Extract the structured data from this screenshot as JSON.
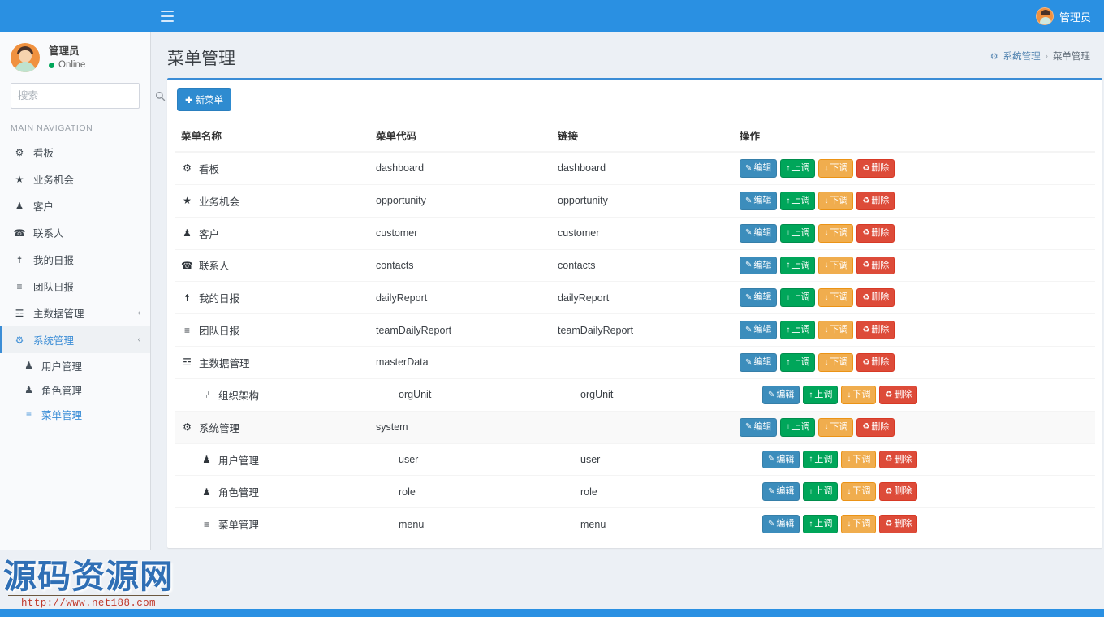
{
  "topbar": {
    "menu_toggle_icon": "hamburger-icon",
    "user_name": "管理员",
    "avatar_icon": "user-avatar-icon"
  },
  "sidebar": {
    "user": {
      "name": "管理员",
      "status": "Online",
      "avatar_icon": "user-avatar-icon"
    },
    "search": {
      "placeholder": "搜索",
      "value": "",
      "icon": "search-icon"
    },
    "nav_header": "MAIN NAVIGATION",
    "items": [
      {
        "label": "看板",
        "icon": "dashboard-icon",
        "glyph": "⚙",
        "arrow": "",
        "active": false
      },
      {
        "label": "业务机会",
        "icon": "star-icon",
        "glyph": "★",
        "arrow": "",
        "active": false
      },
      {
        "label": "客户",
        "icon": "customer-icon",
        "glyph": "♟",
        "arrow": "",
        "active": false
      },
      {
        "label": "联系人",
        "icon": "phone-icon",
        "glyph": "☎",
        "arrow": "",
        "active": false
      },
      {
        "label": "我的日报",
        "icon": "pin-icon",
        "glyph": "☨",
        "arrow": "",
        "active": false
      },
      {
        "label": "团队日报",
        "icon": "list-icon",
        "glyph": "≡",
        "arrow": "",
        "active": false
      },
      {
        "label": "主数据管理",
        "icon": "database-icon",
        "glyph": "☲",
        "arrow": "‹",
        "active": false
      },
      {
        "label": "系统管理",
        "icon": "gear-icon",
        "glyph": "⚙",
        "arrow": "‹",
        "active": true
      }
    ],
    "sub_items": [
      {
        "label": "用户管理",
        "icon": "user-icon",
        "glyph": "♟",
        "current": false
      },
      {
        "label": "角色管理",
        "icon": "users-icon",
        "glyph": "♟",
        "current": false
      },
      {
        "label": "菜单管理",
        "icon": "menu-list-icon",
        "glyph": "≡",
        "current": true
      }
    ]
  },
  "page": {
    "title": "菜单管理",
    "breadcrumb": {
      "icon": "gear-icon",
      "parent": "系统管理",
      "separator": "›",
      "current": "菜单管理"
    },
    "new_button": {
      "label": "新菜单",
      "icon": "plus-icon"
    }
  },
  "table": {
    "columns": [
      "菜单名称",
      "菜单代码",
      "链接",
      "操作"
    ],
    "action_labels": {
      "edit": "编辑",
      "up": "上调",
      "down": "下调",
      "delete": "删除"
    },
    "action_icons": {
      "edit": "edit-pencil-icon",
      "up": "arrow-up-icon",
      "down": "arrow-down-icon",
      "delete": "trash-icon"
    },
    "action_glyphs": {
      "edit": "✎",
      "up": "↑",
      "down": "↓",
      "delete": "Ὕ1"
    },
    "rows": [
      {
        "name": "看板",
        "code": "dashboard",
        "link": "dashboard",
        "icon": "dashboard-icon",
        "glyph": "⚙",
        "indent": false,
        "alt": false
      },
      {
        "name": "业务机会",
        "code": "opportunity",
        "link": "opportunity",
        "icon": "star-icon",
        "glyph": "★",
        "indent": false,
        "alt": false
      },
      {
        "name": "客户",
        "code": "customer",
        "link": "customer",
        "icon": "customer-icon",
        "glyph": "♟",
        "indent": false,
        "alt": false
      },
      {
        "name": "联系人",
        "code": "contacts",
        "link": "contacts",
        "icon": "phone-icon",
        "glyph": "☎",
        "indent": false,
        "alt": false
      },
      {
        "name": "我的日报",
        "code": "dailyReport",
        "link": "dailyReport",
        "icon": "pin-icon",
        "glyph": "☨",
        "indent": false,
        "alt": false
      },
      {
        "name": "团队日报",
        "code": "teamDailyReport",
        "link": "teamDailyReport",
        "icon": "list-icon",
        "glyph": "≡",
        "indent": false,
        "alt": false
      },
      {
        "name": "主数据管理",
        "code": "masterData",
        "link": "",
        "icon": "database-icon",
        "glyph": "☲",
        "indent": false,
        "alt": false
      },
      {
        "name": "组织架构",
        "code": "orgUnit",
        "link": "orgUnit",
        "icon": "sitemap-icon",
        "glyph": "⑂",
        "indent": true,
        "alt": false
      },
      {
        "name": "系统管理",
        "code": "system",
        "link": "",
        "icon": "gear-icon",
        "glyph": "⚙",
        "indent": false,
        "alt": true
      },
      {
        "name": "用户管理",
        "code": "user",
        "link": "user",
        "icon": "user-icon",
        "glyph": "♟",
        "indent": true,
        "alt": false
      },
      {
        "name": "角色管理",
        "code": "role",
        "link": "role",
        "icon": "users-icon",
        "glyph": "♟",
        "indent": true,
        "alt": false
      },
      {
        "name": "菜单管理",
        "code": "menu",
        "link": "menu",
        "icon": "menu-list-icon",
        "glyph": "≡",
        "indent": true,
        "alt": false
      }
    ]
  },
  "watermark": {
    "title": "源码资源网",
    "url": "http://www.net188.com"
  },
  "colors": {
    "brand_blue": "#2a90e2",
    "accent_blue": "#3b8dd6",
    "btn_edit": "#3c8dbc",
    "btn_up": "#00a65a",
    "btn_down": "#f0ad4e",
    "btn_delete": "#dd4b39",
    "online_green": "#00a65a",
    "page_bg": "#ecf0f5"
  }
}
